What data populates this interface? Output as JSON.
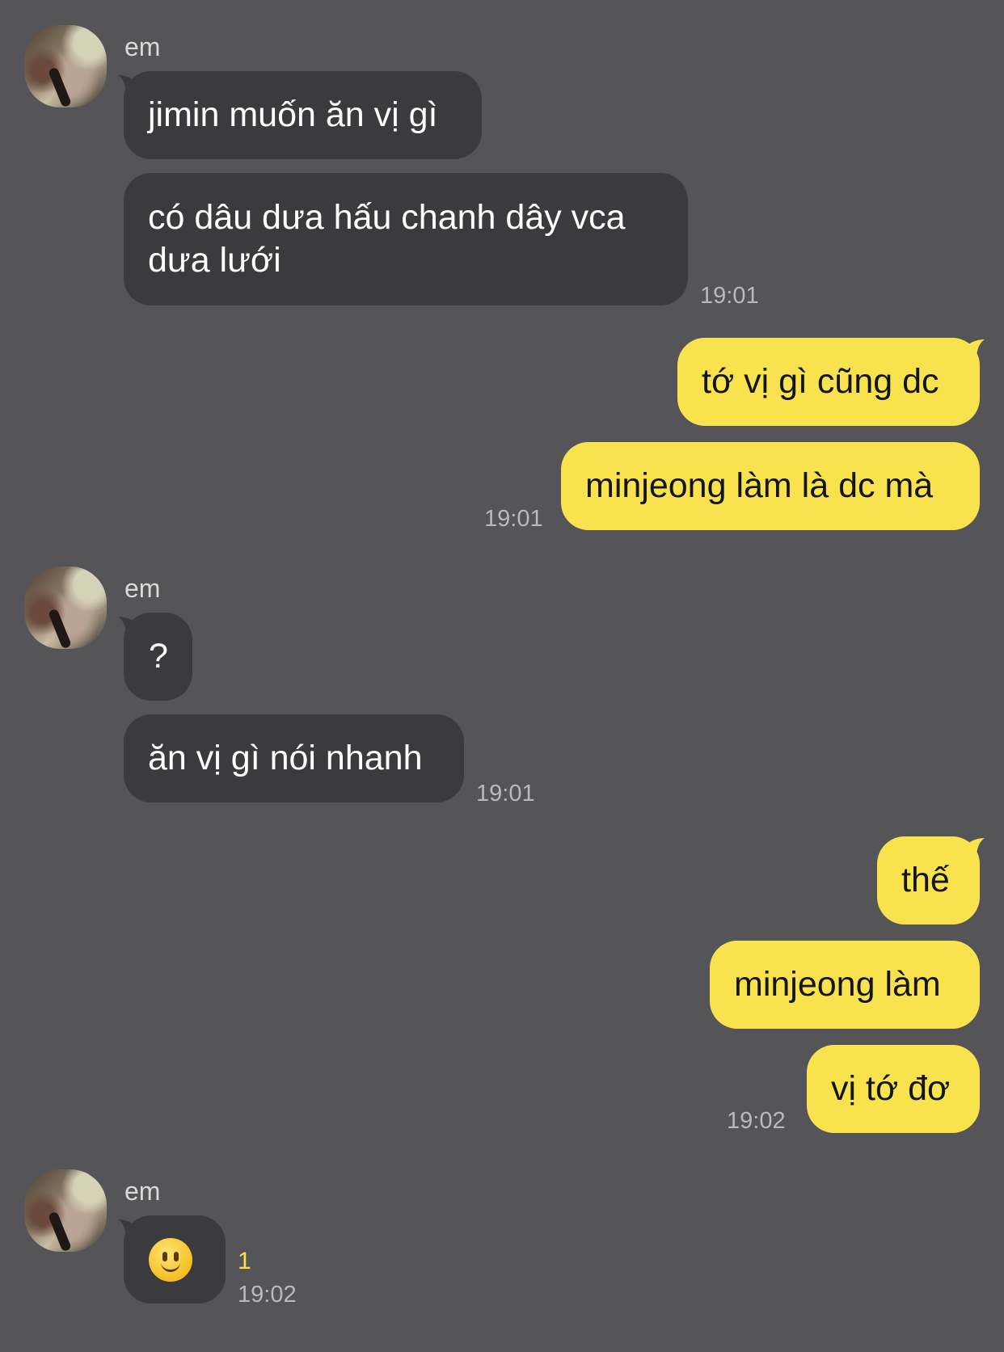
{
  "colors": {
    "background": "#555456",
    "incoming_bubble": "#3b3a3d",
    "outgoing_bubble": "#f8e34e",
    "unread_count": "#f8e34e"
  },
  "messages": {
    "group1": {
      "sender": "em",
      "avatar": "avatar",
      "msg1": "jimin muốn ăn vị gì",
      "msg2": "có dâu dưa hấu chanh dây vca dưa lưới",
      "time": "19:01"
    },
    "group2": {
      "msg1": "tớ vị gì cũng dc",
      "msg2": "minjeong làm là dc mà",
      "time": "19:01"
    },
    "group3": {
      "sender": "em",
      "avatar": "avatar",
      "msg1": "?",
      "msg2": "ăn vị gì nói nhanh",
      "time": "19:01"
    },
    "group4": {
      "msg1": "thế",
      "msg2": "minjeong làm",
      "msg3": "vị tớ đơ",
      "time": "19:02"
    },
    "group5": {
      "sender": "em",
      "avatar": "avatar",
      "emoji": "slightly-smiling-face-icon",
      "unread": "1",
      "time": "19:02"
    }
  }
}
